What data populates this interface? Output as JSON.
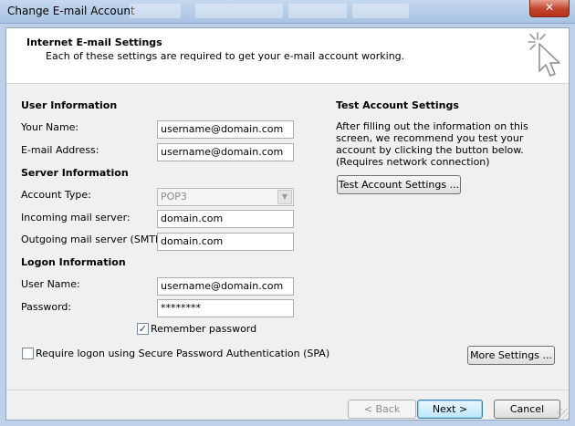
{
  "window": {
    "title": "Change E-mail Account",
    "close_glyph": "✕"
  },
  "header": {
    "title": "Internet E-mail Settings",
    "subtitle": "Each of these settings are required to get your e-mail account working."
  },
  "user_info": {
    "section": "User Information",
    "name_label": "Your Name:",
    "name_value": "username@domain.com",
    "email_label": "E-mail Address:",
    "email_value": "username@domain.com"
  },
  "server_info": {
    "section": "Server Information",
    "account_type_label": "Account Type:",
    "account_type_value": "POP3",
    "dropdown_glyph": "▼",
    "incoming_label": "Incoming mail server:",
    "incoming_value": "domain.com",
    "outgoing_label": "Outgoing mail server (SMTP):",
    "outgoing_value": "domain.com"
  },
  "logon_info": {
    "section": "Logon Information",
    "username_label": "User Name:",
    "username_value": "username@domain.com",
    "password_label": "Password:",
    "password_value": "********",
    "remember_label": "Remember password",
    "remember_checked": true,
    "check_glyph": "✓",
    "spa_label": "Require logon using Secure Password Authentication (SPA)",
    "spa_checked": false
  },
  "test_settings": {
    "section": "Test Account Settings",
    "description": "After filling out the information on this screen, we recommend you test your account by clicking the button below. (Requires network connection)",
    "test_button": "Test Account Settings ..."
  },
  "more_settings_button": "More Settings ...",
  "footer": {
    "back_button": "< Back",
    "next_button": "Next >",
    "cancel_button": "Cancel"
  }
}
